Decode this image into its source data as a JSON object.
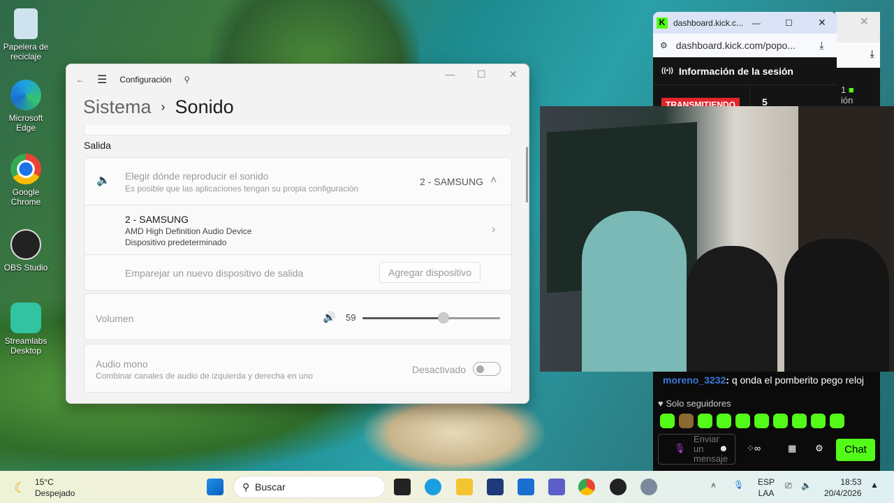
{
  "desktop": {
    "icons": [
      {
        "label": "Papelera de reciclaje",
        "icon": "recycle-bin-icon"
      },
      {
        "label": "Microsoft Edge",
        "icon": "edge-icon"
      },
      {
        "label": "Google Chrome",
        "icon": "chrome-icon"
      },
      {
        "label": "OBS Studio",
        "icon": "obs-icon"
      },
      {
        "label": "Streamlabs Desktop",
        "icon": "streamlabs-icon"
      }
    ]
  },
  "settings": {
    "app_title": "Configuración",
    "breadcrumb_parent": "Sistema",
    "breadcrumb_current": "Sonido",
    "section": "Salida",
    "choose_title": "Elegir dónde reproducir el sonido",
    "choose_sub": "Es posible que las aplicaciones tengan su propia configuración",
    "choose_value": "2 - SAMSUNG",
    "device_name": "2 - SAMSUNG",
    "device_driver": "AMD High Definition Audio Device",
    "device_status": "Dispositivo predeterminado",
    "pair_label": "Emparejar un nuevo dispositivo de salida",
    "add_button": "Agregar dispositivo",
    "volume_label": "Volumen",
    "volume_value": "59",
    "volume_level": 59,
    "mono_title": "Audio mono",
    "mono_sub": "Combinar canales de audio de izquierda y derecha en uno",
    "mono_state": "Desactivado",
    "mono_on": false
  },
  "kick": {
    "tab_title": "dashboard.kick.c...",
    "url": "dashboard.kick.com/popo...",
    "session_title": "Información de la sesión",
    "live_badge": "TRANSMITIENDO",
    "viewers": "5",
    "side_count": "1",
    "side_text": "ión",
    "brand": "#53fc18"
  },
  "chat": {
    "username": "moreno_3232",
    "message": "q onda el pomberito pego reloj",
    "followers_only": "Solo seguidores",
    "input_placeholder": "Enviar un mensaje",
    "chat_button": "Chat"
  },
  "taskbar": {
    "weather_temp": "15°C",
    "weather_desc": "Despejado",
    "search": "Buscar",
    "lang1": "ESP",
    "lang2": "LAA",
    "time": "18:53",
    "date": "20/4/2026"
  }
}
